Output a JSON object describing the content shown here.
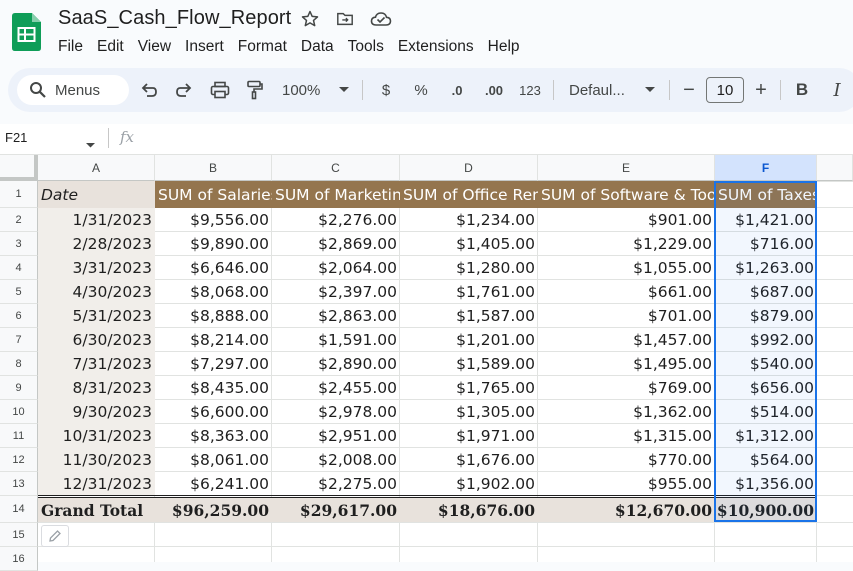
{
  "app": {
    "doc_title": "SaaS_Cash_Flow_Report",
    "menu": [
      "File",
      "Edit",
      "View",
      "Insert",
      "Format",
      "Data",
      "Tools",
      "Extensions",
      "Help"
    ]
  },
  "toolbar": {
    "search_label": "Menus",
    "zoom": "100%",
    "currency": "$",
    "percent": "%",
    "decrease_decimal": ".0",
    "increase_decimal": ".00",
    "number_format": "123",
    "font": "Defaul...",
    "font_size": "10",
    "minus": "−",
    "plus": "+",
    "bold": "B",
    "italic": "I"
  },
  "formula_bar": {
    "cell_ref": "F21",
    "fx": "fx",
    "content": ""
  },
  "columns": [
    "A",
    "B",
    "C",
    "D",
    "E",
    "F"
  ],
  "selected_column": "F",
  "rows": [
    "1",
    "2",
    "3",
    "4",
    "5",
    "6",
    "7",
    "8",
    "9",
    "10",
    "11",
    "12",
    "13",
    "14",
    "15",
    "16"
  ],
  "table": {
    "headers": [
      "Date",
      "SUM of Salaries",
      "SUM of Marketing",
      "SUM of Office Rent",
      "SUM of Software & Tools",
      "SUM of Taxes"
    ],
    "data": [
      [
        "1/31/2023",
        "$9,556.00",
        "$2,276.00",
        "$1,234.00",
        "$901.00",
        "$1,421.00"
      ],
      [
        "2/28/2023",
        "$9,890.00",
        "$2,869.00",
        "$1,405.00",
        "$1,229.00",
        "$716.00"
      ],
      [
        "3/31/2023",
        "$6,646.00",
        "$2,064.00",
        "$1,280.00",
        "$1,055.00",
        "$1,263.00"
      ],
      [
        "4/30/2023",
        "$8,068.00",
        "$2,397.00",
        "$1,761.00",
        "$661.00",
        "$687.00"
      ],
      [
        "5/31/2023",
        "$8,888.00",
        "$2,863.00",
        "$1,587.00",
        "$701.00",
        "$879.00"
      ],
      [
        "6/30/2023",
        "$8,214.00",
        "$1,591.00",
        "$1,201.00",
        "$1,457.00",
        "$992.00"
      ],
      [
        "7/31/2023",
        "$7,297.00",
        "$2,890.00",
        "$1,589.00",
        "$1,495.00",
        "$540.00"
      ],
      [
        "8/31/2023",
        "$8,435.00",
        "$2,455.00",
        "$1,765.00",
        "$769.00",
        "$656.00"
      ],
      [
        "9/30/2023",
        "$6,600.00",
        "$2,978.00",
        "$1,305.00",
        "$1,362.00",
        "$514.00"
      ],
      [
        "10/31/2023",
        "$8,363.00",
        "$2,951.00",
        "$1,971.00",
        "$1,315.00",
        "$1,312.00"
      ],
      [
        "11/30/2023",
        "$8,061.00",
        "$2,008.00",
        "$1,676.00",
        "$770.00",
        "$564.00"
      ],
      [
        "12/31/2023",
        "$6,241.00",
        "$2,275.00",
        "$1,902.00",
        "$955.00",
        "$1,356.00"
      ]
    ],
    "total": [
      "Grand Total",
      "$96,259.00",
      "$29,617.00",
      "$18,676.00",
      "$12,670.00",
      "$10,900.00"
    ]
  },
  "colors": {
    "header_fill": "#94754e",
    "date_fill": "#f1eeea",
    "total_fill": "#e8e2dc",
    "selection": "#1a73e8",
    "sheets_green": "#0f9d58"
  }
}
